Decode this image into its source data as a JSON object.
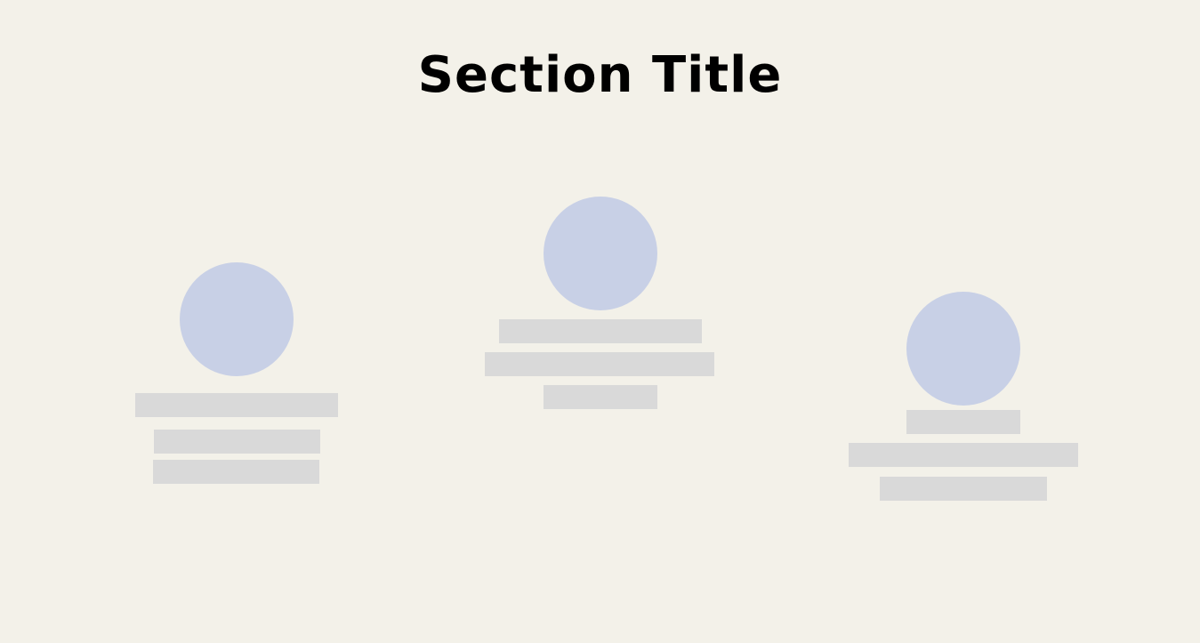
{
  "page": {
    "title": "Section Title",
    "background_color": "#f3f1e9",
    "title_color": "#000000"
  },
  "placeholders": {
    "avatar_color": "#c8d0e6",
    "line_color": "#d9d9d9"
  },
  "cards": [
    {
      "id": "card-1",
      "line_count": 3
    },
    {
      "id": "card-2",
      "line_count": 3
    },
    {
      "id": "card-3",
      "line_count": 3
    }
  ]
}
